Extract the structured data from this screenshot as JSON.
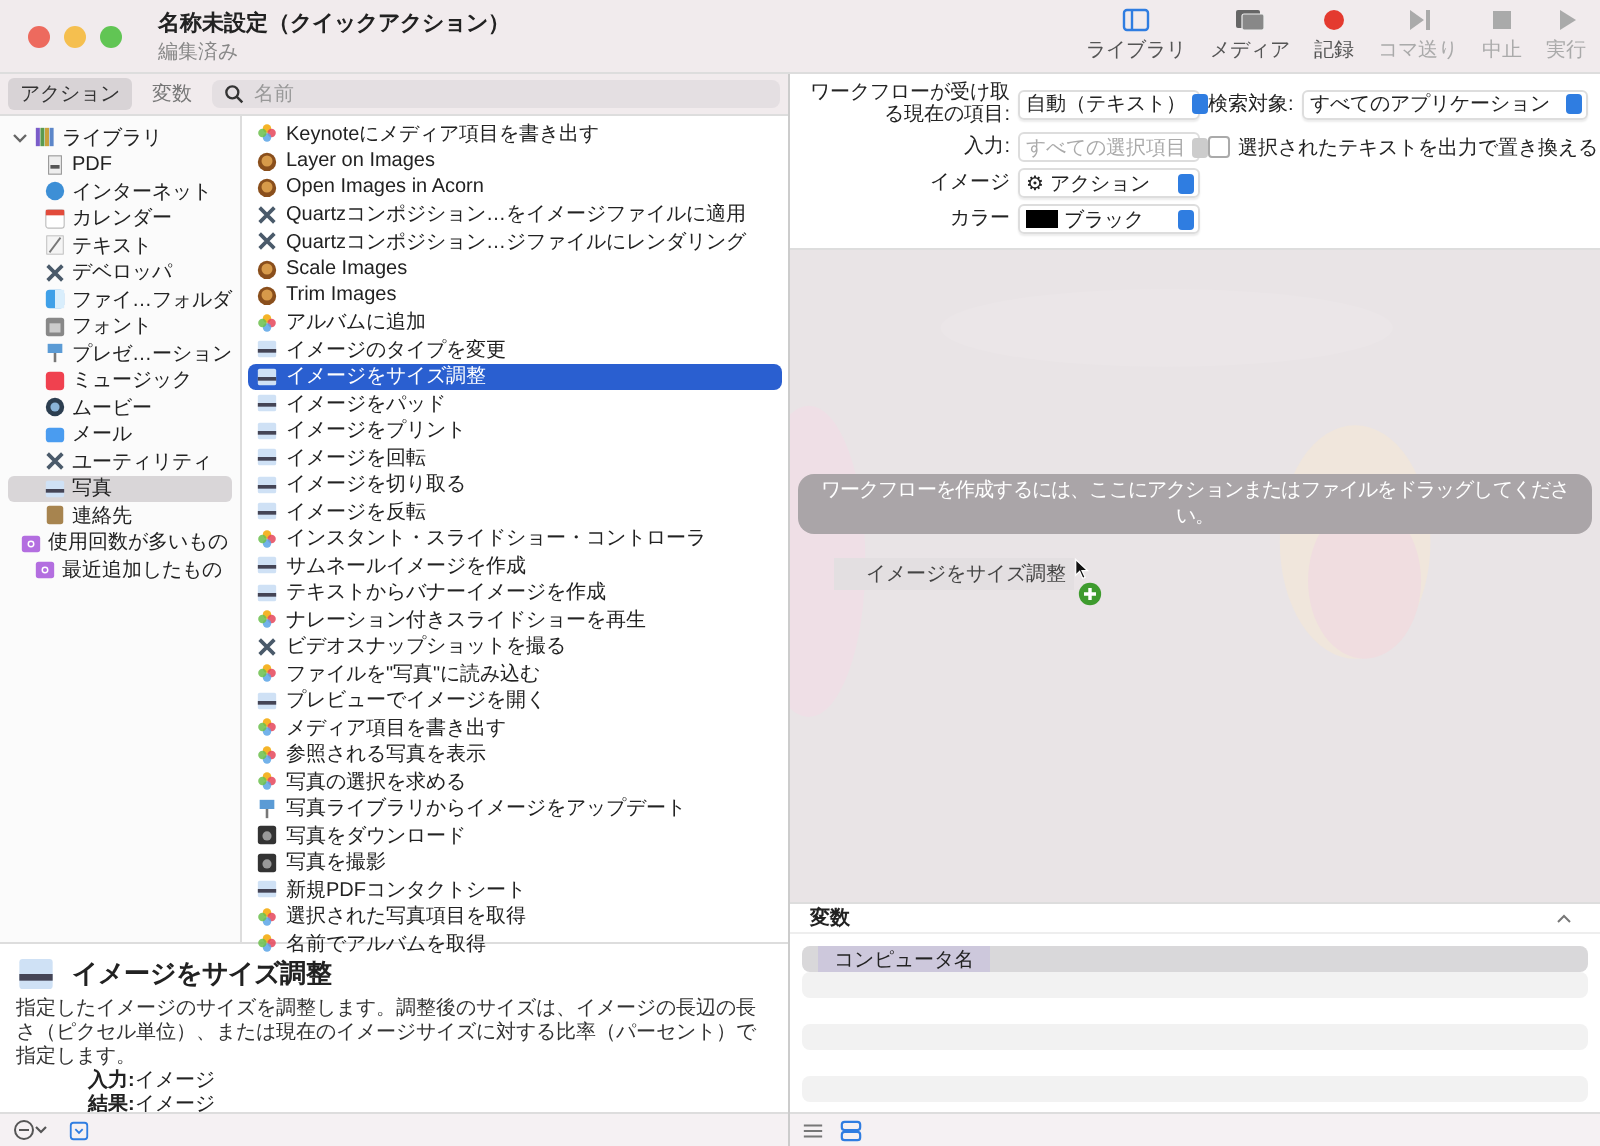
{
  "window": {
    "title": "名称未設定（クイックアクション）",
    "subtitle": "編集済み"
  },
  "toolbar": [
    {
      "label": "ライブラリ",
      "kind": "library",
      "disabled": false
    },
    {
      "label": "メディア",
      "kind": "media",
      "disabled": false
    },
    {
      "label": "記録",
      "kind": "record",
      "disabled": false
    },
    {
      "label": "コマ送り",
      "kind": "step",
      "disabled": true
    },
    {
      "label": "中止",
      "kind": "stop",
      "disabled": true
    },
    {
      "label": "実行",
      "kind": "run",
      "disabled": true
    }
  ],
  "tabs": [
    {
      "label": "アクション",
      "selected": true
    },
    {
      "label": "変数",
      "selected": false
    }
  ],
  "search": {
    "placeholder": "名前"
  },
  "library": [
    {
      "label": "ライブラリ",
      "kind": "library",
      "selected": false,
      "expanded": true,
      "children": [
        {
          "label": "PDF",
          "kind": "pdf",
          "selected": false
        },
        {
          "label": "インターネット",
          "kind": "globe",
          "selected": false
        },
        {
          "label": "カレンダー",
          "kind": "calendar",
          "selected": false
        },
        {
          "label": "テキスト",
          "kind": "text",
          "selected": false
        },
        {
          "label": "デベロッパ",
          "kind": "tools",
          "selected": false
        },
        {
          "label": "ファイ…フォルダ",
          "kind": "finder",
          "selected": false
        },
        {
          "label": "フォント",
          "kind": "font",
          "selected": false
        },
        {
          "label": "プレゼ…ーション",
          "kind": "keynote",
          "selected": false
        },
        {
          "label": "ミュージック",
          "kind": "music",
          "selected": false
        },
        {
          "label": "ムービー",
          "kind": "movie",
          "selected": false
        },
        {
          "label": "メール",
          "kind": "mail",
          "selected": false
        },
        {
          "label": "ユーティリティ",
          "kind": "tools",
          "selected": false
        },
        {
          "label": "写真",
          "kind": "preview",
          "selected": true
        },
        {
          "label": "連絡先",
          "kind": "contacts",
          "selected": false
        }
      ]
    },
    {
      "label": "使用回数が多いもの",
      "kind": "folder",
      "selected": false
    },
    {
      "label": "最近追加したもの",
      "kind": "folder",
      "selected": false
    }
  ],
  "actions": [
    {
      "label": "Keynoteにメディア項目を書き出す",
      "kind": "photos",
      "selected": false
    },
    {
      "label": "Layer on Images",
      "kind": "acorn",
      "selected": false
    },
    {
      "label": "Open Images in Acorn",
      "kind": "acorn",
      "selected": false
    },
    {
      "label": "Quartzコンポジション…をイメージファイルに適用",
      "kind": "tools",
      "selected": false
    },
    {
      "label": "Quartzコンポジション…ジファイルにレンダリング",
      "kind": "tools",
      "selected": false
    },
    {
      "label": "Scale Images",
      "kind": "acorn",
      "selected": false
    },
    {
      "label": "Trim Images",
      "kind": "acorn",
      "selected": false
    },
    {
      "label": "アルバムに追加",
      "kind": "photos",
      "selected": false
    },
    {
      "label": "イメージのタイプを変更",
      "kind": "preview",
      "selected": false
    },
    {
      "label": "イメージをサイズ調整",
      "kind": "preview",
      "selected": true
    },
    {
      "label": "イメージをパッド",
      "kind": "preview",
      "selected": false
    },
    {
      "label": "イメージをプリント",
      "kind": "preview",
      "selected": false
    },
    {
      "label": "イメージを回転",
      "kind": "preview",
      "selected": false
    },
    {
      "label": "イメージを切り取る",
      "kind": "preview",
      "selected": false
    },
    {
      "label": "イメージを反転",
      "kind": "preview",
      "selected": false
    },
    {
      "label": "インスタント・スライドショー・コントローラ",
      "kind": "photos",
      "selected": false
    },
    {
      "label": "サムネールイメージを作成",
      "kind": "preview",
      "selected": false
    },
    {
      "label": "テキストからバナーイメージを作成",
      "kind": "preview",
      "selected": false
    },
    {
      "label": "ナレーション付きスライドショーを再生",
      "kind": "photos",
      "selected": false
    },
    {
      "label": "ビデオスナップショットを撮る",
      "kind": "tools",
      "selected": false
    },
    {
      "label": "ファイルを\"写真\"に読み込む",
      "kind": "photos",
      "selected": false
    },
    {
      "label": "プレビューでイメージを開く",
      "kind": "preview",
      "selected": false
    },
    {
      "label": "メディア項目を書き出す",
      "kind": "photos",
      "selected": false
    },
    {
      "label": "参照される写真を表示",
      "kind": "photos",
      "selected": false
    },
    {
      "label": "写真の選択を求める",
      "kind": "photos",
      "selected": false
    },
    {
      "label": "写真ライブラリからイメージをアップデート",
      "kind": "keynote",
      "selected": false
    },
    {
      "label": "写真をダウンロード",
      "kind": "camera",
      "selected": false
    },
    {
      "label": "写真を撮影",
      "kind": "camera",
      "selected": false
    },
    {
      "label": "新規PDFコンタクトシート",
      "kind": "preview",
      "selected": false
    },
    {
      "label": "選択された写真項目を取得",
      "kind": "photos",
      "selected": false
    },
    {
      "label": "名前でアルバムを取得",
      "kind": "photos",
      "selected": false
    }
  ],
  "description": {
    "title": "イメージをサイズ調整",
    "body": "指定したイメージのサイズを調整します。調整後のサイズは、イメージの長辺の長さ（ピクセル単位）、または現在のイメージサイズに対する比率（パーセント）で指定します。",
    "io": [
      {
        "label": "入力:",
        "value": "イメージ"
      },
      {
        "label": "結果:",
        "value": "イメージ"
      }
    ]
  },
  "settings": {
    "fields": [
      {
        "label": "ワークフローが受け取る現在の項目:",
        "value": "自動（テキスト）",
        "disabled": false
      },
      {
        "label": "検索対象:",
        "value": "すべてのアプリケーション",
        "disabled": false
      },
      {
        "label": "入力:",
        "value": "すべての選択項目",
        "disabled": true
      },
      {
        "label": "イメージ",
        "value": "⚙ アクション",
        "disabled": false
      },
      {
        "label": "カラー",
        "value": "ブラック",
        "disabled": false
      }
    ],
    "checkbox": {
      "label": "選択されたテキストを出力で置き換える",
      "checked": false
    }
  },
  "canvas": {
    "hint": "ワークフローを作成するには、ここにアクションまたはファイルをドラッグしてください。",
    "dragged": "イメージをサイズ調整"
  },
  "variables": {
    "title": "変数",
    "expanded": true,
    "rows": [
      {
        "token": "コンピュータ名"
      },
      {},
      {},
      {}
    ]
  }
}
